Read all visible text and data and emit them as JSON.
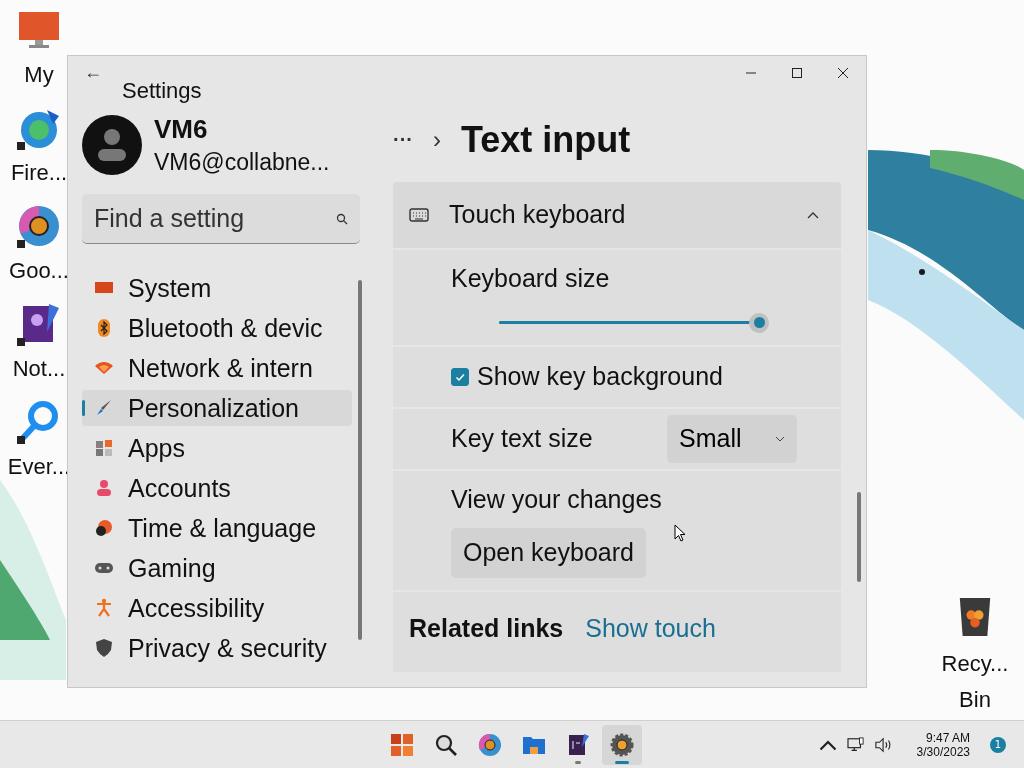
{
  "desktop_icons": [
    {
      "label": "My"
    },
    {
      "label": "Fire..."
    },
    {
      "label": "Goo..."
    },
    {
      "label": "Not..."
    },
    {
      "label": "Ever..."
    }
  ],
  "recycle_bin": {
    "label": "Recy...\nBin"
  },
  "window": {
    "title": "Settings",
    "back": "←"
  },
  "profile": {
    "name": "VM6",
    "email": "VM6@collabne..."
  },
  "search": {
    "placeholder": "Find a setting"
  },
  "nav_items": [
    {
      "label": "System",
      "selected": false
    },
    {
      "label": "Bluetooth & devic",
      "selected": false
    },
    {
      "label": "Network & intern",
      "selected": false
    },
    {
      "label": "Personalization",
      "selected": true
    },
    {
      "label": "Apps",
      "selected": false
    },
    {
      "label": "Accounts",
      "selected": false
    },
    {
      "label": "Time & language",
      "selected": false
    },
    {
      "label": "Gaming",
      "selected": false
    },
    {
      "label": "Accessibility",
      "selected": false
    },
    {
      "label": "Privacy & security",
      "selected": false
    }
  ],
  "breadcrumb": {
    "more": "···",
    "separator": "›",
    "title": "Text input"
  },
  "section": {
    "title": "Touch keyboard",
    "expanded": true
  },
  "keyboard_size": {
    "label": "Keyboard size",
    "level": 1.0
  },
  "key_background": {
    "label": "Show key background",
    "checked": true
  },
  "key_text_size": {
    "label": "Key text size",
    "value": "Small"
  },
  "view_changes": {
    "label": "View your changes",
    "button": "Open keyboard"
  },
  "related_links": {
    "label": "Related links",
    "links": [
      "Show touch"
    ]
  },
  "taskbar": {
    "time": "9:47 AM",
    "date": "3/30/2023",
    "notifications": "1"
  }
}
